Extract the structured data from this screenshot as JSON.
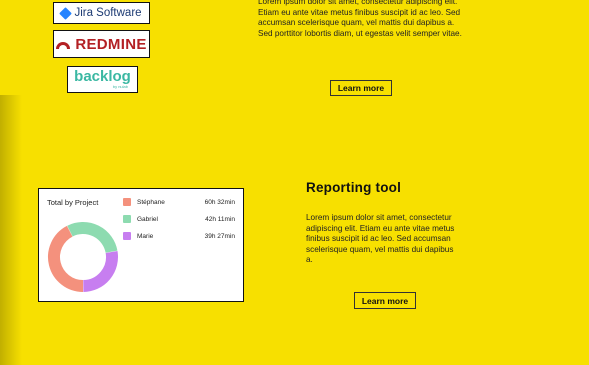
{
  "logos": {
    "jira": {
      "label": "Jira Software",
      "color": "#2684ff"
    },
    "redmine": {
      "label": "REDMINE",
      "color": "#b32024"
    },
    "backlog": {
      "label": "backlog",
      "sub": "by nulab",
      "color": "#3bb8a3"
    }
  },
  "integrations": {
    "body": "Lorem ipsum dolor sit amet, consectetur adipiscing elit. Etiam eu ante vitae metus finibus suscipit id ac leo. Sed accumsan scelerisque quam, vel mattis dui dapibus a. Sed porttitor lobortis diam, ut egestas velit semper vitae.",
    "button_label": "Learn more"
  },
  "reporting": {
    "heading": "Reporting tool",
    "body": "Lorem ipsum dolor sit amet, consectetur adipiscing elit. Etiam eu ante vitae metus finibus suscipit id ac leo. Sed accumsan scelerisque quam, vel mattis dui dapibus a.",
    "button_label": "Learn more"
  },
  "report_card": {
    "title": "Total by Project",
    "entries": [
      {
        "name": "Stéphane",
        "time": "60h 32min",
        "minutes": 3632,
        "color": "#f4917d"
      },
      {
        "name": "Gabriel",
        "time": "42h 11min",
        "minutes": 2531,
        "color": "#8ddbb0"
      },
      {
        "name": "Marie",
        "time": "39h 27min",
        "minutes": 2367,
        "color": "#c77ef0"
      }
    ]
  },
  "colors": {
    "background": "#f7e000"
  }
}
